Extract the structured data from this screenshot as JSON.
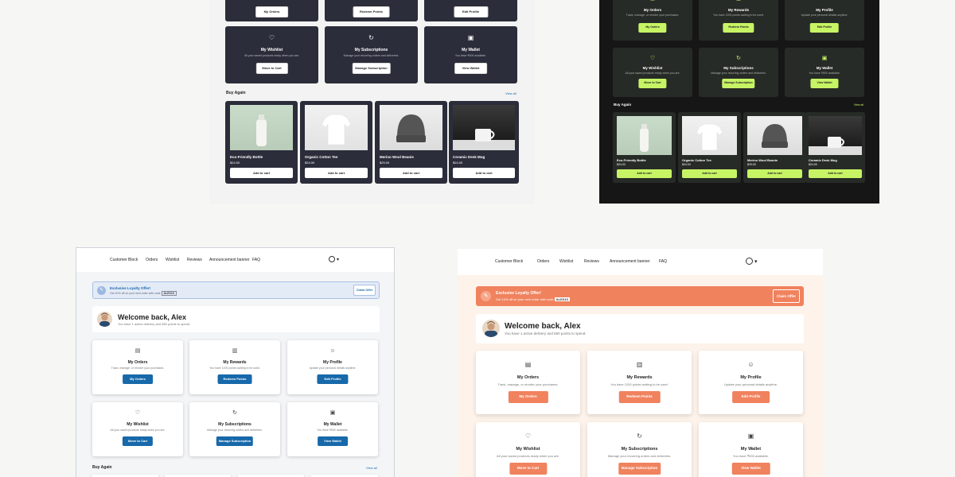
{
  "actions": {
    "orders": {
      "title": "My Orders",
      "desc": "Track, manage, or reorder your purchases.",
      "button": "My Orders",
      "icon": "box-icon"
    },
    "rewards": {
      "title": "My Rewards",
      "desc": "You have 1200 points waiting to be used.",
      "button": "Redeem Points",
      "icon": "gift-icon"
    },
    "profile": {
      "title": "My Profile",
      "desc": "Update your personal details anytime.",
      "button": "Edit Profile",
      "icon": "user-circle-icon"
    },
    "wishlist": {
      "title": "My Wishlist",
      "desc": "All your saved products ready when you are.",
      "button": "Move to Cart",
      "icon": "heart-icon"
    },
    "subscriptions": {
      "title": "My Subscriptions",
      "desc": "Manage your recurring orders and deliveries.",
      "button": "Manage Subscription",
      "icon": "refresh-icon"
    },
    "wallet": {
      "title": "My Wallet",
      "desc": "You have ₹500 available.",
      "button": "View Wallet",
      "icon": "wallet-icon"
    }
  },
  "buy_again": {
    "title": "Buy Again",
    "view_all": "View all",
    "add_label": "Add to cart",
    "products": [
      {
        "name": "Eco-Friendly Bottle",
        "price": "$24.00"
      },
      {
        "name": "Organic Cotton Tee",
        "price": "$24.00"
      },
      {
        "name": "Merino Wool Beanie",
        "price": "$29.00"
      },
      {
        "name": "Ceramic Desk Mug",
        "price": "$24.00"
      }
    ]
  },
  "nav": {
    "brand": "Customer Block",
    "links": [
      "Orders",
      "Wishlist",
      "Reviews",
      "Announcement banner",
      "FAQ"
    ],
    "account_icon": "user-circle-icon",
    "caret_icon": "caret-down-icon"
  },
  "banner": {
    "title": "Exclusive Loyalty Offer!",
    "text": "Get 10% off on your next order with code",
    "code": "ALEX10",
    "button": "Claim Offer",
    "icon": "tag-icon"
  },
  "welcome": {
    "title": "Welcome back, Alex",
    "subtitle": "You have 1 active delivery and 850 points to spend."
  },
  "colors": {
    "dark_card": "#2b2d3a",
    "lime_accent": "#c7f464",
    "blue_accent": "#1769aa",
    "orange_accent": "#f0825e"
  }
}
